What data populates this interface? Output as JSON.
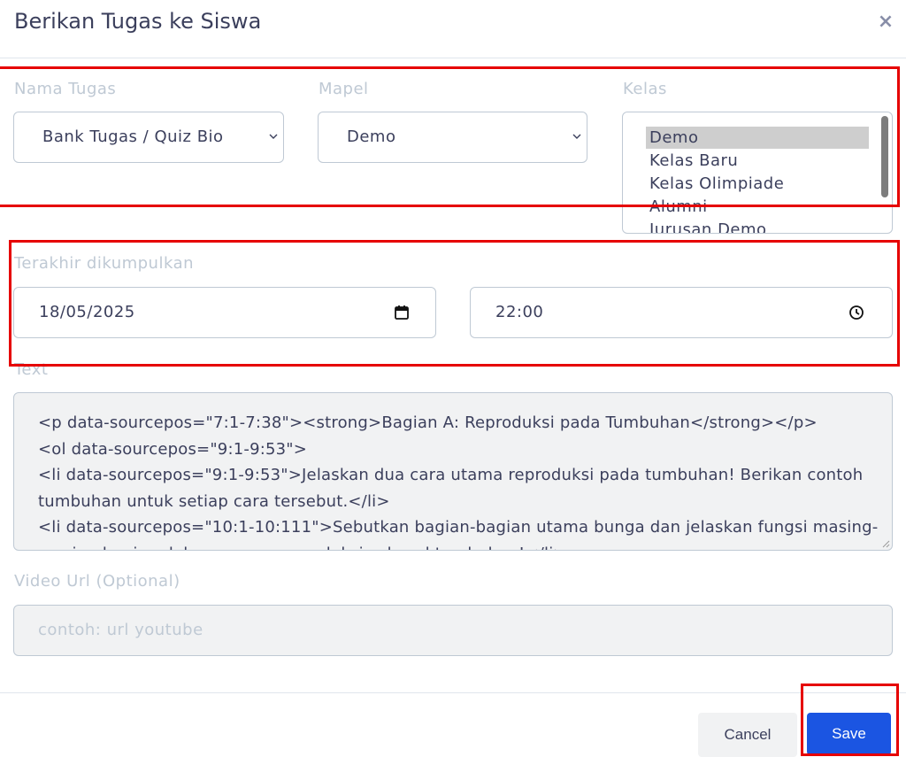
{
  "modal": {
    "title": "Berikan Tugas ke Siswa",
    "close_label": "×"
  },
  "fields": {
    "nama_tugas": {
      "label": "Nama Tugas",
      "value": "Bank Tugas / Quiz Bio"
    },
    "mapel": {
      "label": "Mapel",
      "value": "Demo"
    },
    "kelas": {
      "label": "Kelas",
      "options": [
        "Demo",
        "Kelas Baru",
        "Kelas Olimpiade",
        "Alumni",
        "Jurusan Demo"
      ],
      "selected": "Demo"
    },
    "deadline": {
      "label": "Terakhir dikumpulkan",
      "date": "18/05/2025",
      "time": "22:00"
    },
    "text": {
      "label": "Text",
      "value": "<p data-sourcepos=\"7:1-7:38\"><strong>Bagian A: Reproduksi pada Tumbuhan</strong></p>\n<ol data-sourcepos=\"9:1-9:53\">\n<li data-sourcepos=\"9:1-9:53\">Jelaskan dua cara utama reproduksi pada tumbuhan! Berikan contoh tumbuhan untuk setiap cara tersebut.</li>\n<li data-sourcepos=\"10:1-10:111\">Sebutkan bagian-bagian utama bunga dan jelaskan fungsi masing-masing bagian dalam proses reproduksi seksual tumbuhan!</li>"
    },
    "video_url": {
      "label": "Video Url (Optional)",
      "placeholder": "contoh: url youtube"
    }
  },
  "footer": {
    "cancel_label": "Cancel",
    "save_label": "Save"
  },
  "icons": {
    "close": "close-icon",
    "select_chevron": "chevron-down-icon",
    "calendar": "calendar-icon",
    "clock": "clock-icon"
  },
  "colors": {
    "primary": "#1b55e2",
    "highlight": "#e60000",
    "label": "#bfc9d4",
    "text": "#3b3f5c"
  }
}
